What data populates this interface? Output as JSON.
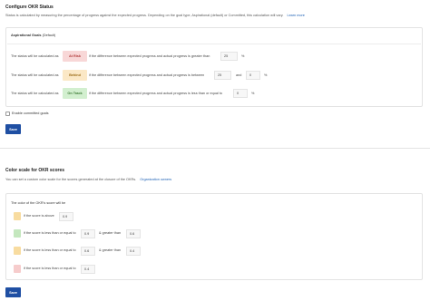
{
  "okr": {
    "title": "Configure OKR Status",
    "description": "Status is calculated by measuring the percentage of progress against the expected progress. Depending on the goal type, Aspirational (default) or Committed, this calculation will vary.",
    "learn_more": "Learn more",
    "panel_title": "Aspirational Goals",
    "panel_title_suffix": " (Default)",
    "rows": [
      {
        "prefix": "The status will be calculated as",
        "badge": "At Risk",
        "badge_color": "#f8d7d7",
        "badge_text_color": "#b03a3a",
        "text": "if the difference between expected progress and actual progress is greater than",
        "value": "25",
        "unit": "%"
      },
      {
        "prefix": "The status will be calculated as",
        "badge": "Behind",
        "badge_color": "#fbe8c6",
        "badge_text_color": "#9a6a14",
        "text": "if the difference between expected progress and actual progress is between",
        "value": "25",
        "and_label": "and",
        "value2": "0",
        "unit": "%"
      },
      {
        "prefix": "The status will be calculated as",
        "badge": "On Track",
        "badge_color": "#d2efcf",
        "badge_text_color": "#3b7a33",
        "text": "if the difference between expected progress and actual progress is less than or equal to",
        "value": "0",
        "unit": "%"
      }
    ],
    "committed_label": "Enable committed goals",
    "save_label": "Save"
  },
  "scale": {
    "title": "Color scale for OKR scores",
    "description": "You can set a custom color scale for the scores generated at the closure of the OKRs.",
    "org_owners": "Organization owners",
    "panel_title": "The color of the OKR's score will be",
    "rows": [
      {
        "color": "#f8dca0",
        "text": "if the score is above",
        "value": "0.9"
      },
      {
        "color": "#c4e7be",
        "text": "if the score is less than or equal to",
        "value": "0.9",
        "text2": "& greater than",
        "value2": "0.6"
      },
      {
        "color": "#f8dca0",
        "text": "if the score is less than or equal to",
        "value": "0.6",
        "text2": "& greater than",
        "value2": "0.4"
      },
      {
        "color": "#f6cccc",
        "text": "if the score is less than or equal to",
        "value": "0.4"
      }
    ],
    "save_label": "Save"
  }
}
